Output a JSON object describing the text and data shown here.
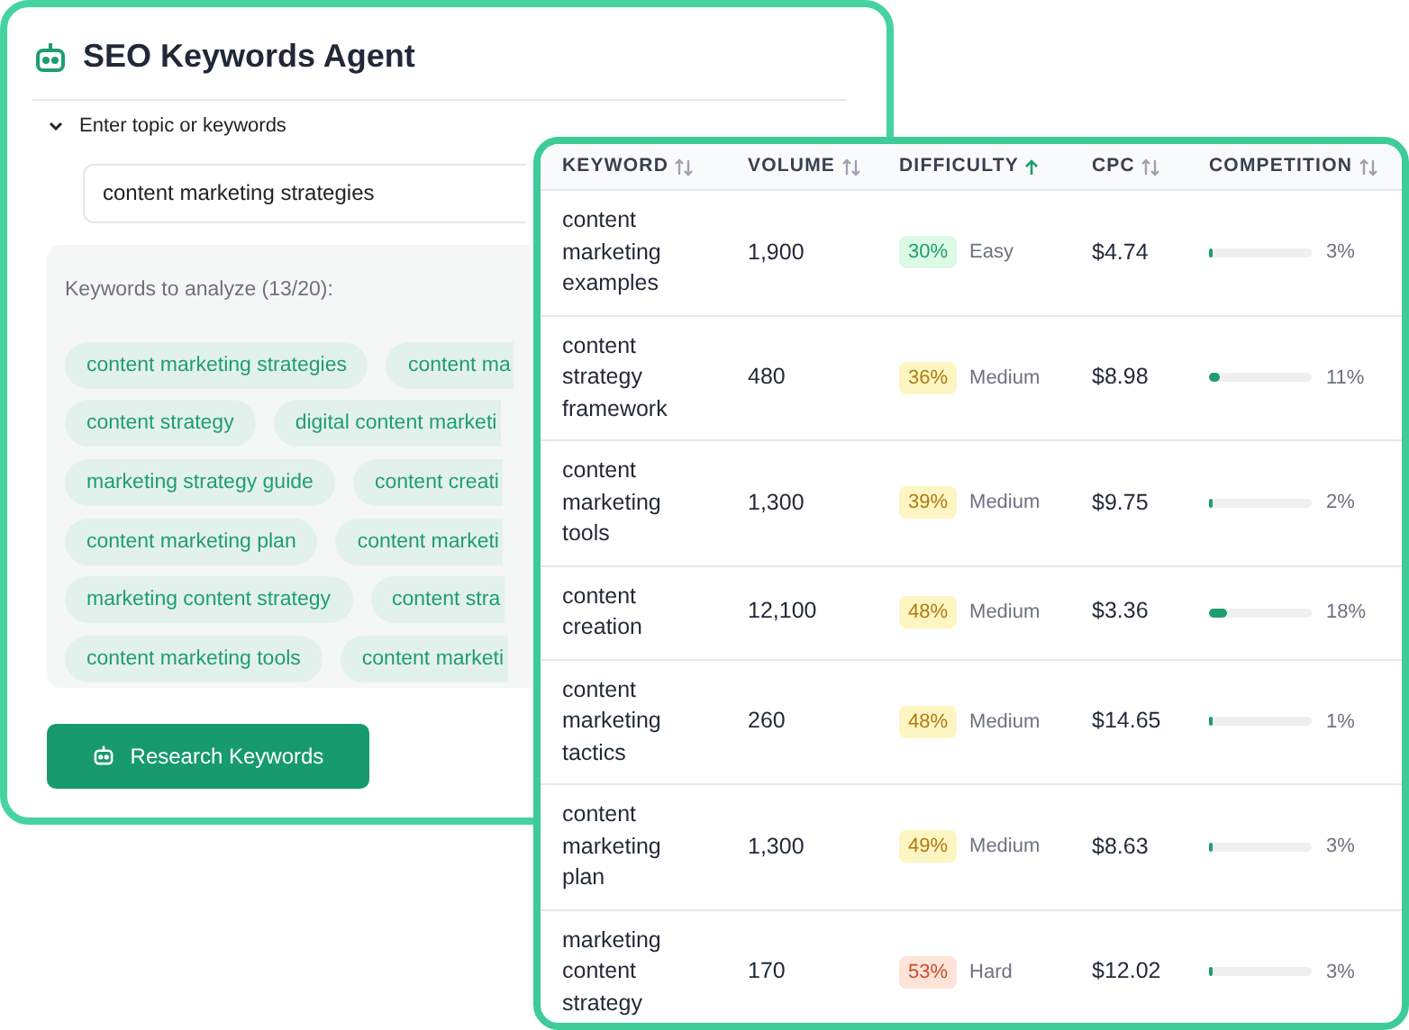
{
  "agent": {
    "title": "SEO Keywords Agent",
    "section_label": "Enter topic or keywords",
    "expanded": true,
    "input": {
      "value": "content marketing strategies"
    },
    "keywords_label": "Keywords to analyze (13/20):",
    "chips": [
      [
        "content marketing strategies",
        "content ma"
      ],
      [
        "content strategy",
        "digital content marketi"
      ],
      [
        "marketing strategy guide",
        "content creati"
      ],
      [
        "content marketing plan",
        "content marketi"
      ],
      [
        "marketing content strategy",
        "content stra"
      ],
      [
        "content marketing tools",
        "content marketi"
      ]
    ],
    "button": "Research Keywords"
  },
  "table": {
    "columns": [
      {
        "label": "KEYWORD",
        "sorted": false
      },
      {
        "label": "VOLUME",
        "sorted": false
      },
      {
        "label": "DIFFICULTY",
        "sorted": true
      },
      {
        "label": "CPC",
        "sorted": false
      },
      {
        "label": "COMPETITION",
        "sorted": false
      }
    ],
    "rows": [
      {
        "keyword": "content marketing examples",
        "volume": "1,900",
        "difficulty": "30%",
        "kind": "easy",
        "rating": "Easy",
        "cpc": "$4.74",
        "level": 0.03,
        "competition": "3%"
      },
      {
        "keyword": "content strategy framework",
        "volume": "480",
        "difficulty": "36%",
        "kind": "medium",
        "rating": "Medium",
        "cpc": "$8.98",
        "level": 0.11,
        "competition": "11%"
      },
      {
        "keyword": "content marketing tools",
        "volume": "1,300",
        "difficulty": "39%",
        "kind": "medium",
        "rating": "Medium",
        "cpc": "$9.75",
        "level": 0.02,
        "competition": "2%"
      },
      {
        "keyword": "content creation",
        "volume": "12,100",
        "difficulty": "48%",
        "kind": "medium",
        "rating": "Medium",
        "cpc": "$3.36",
        "level": 0.18,
        "competition": "18%"
      },
      {
        "keyword": "content marketing tactics",
        "volume": "260",
        "difficulty": "48%",
        "kind": "medium",
        "rating": "Medium",
        "cpc": "$14.65",
        "level": 0.01,
        "competition": "1%"
      },
      {
        "keyword": "content marketing plan",
        "volume": "1,300",
        "difficulty": "49%",
        "kind": "medium",
        "rating": "Medium",
        "cpc": "$8.63",
        "level": 0.03,
        "competition": "3%"
      },
      {
        "keyword": "marketing content strategy",
        "volume": "170",
        "difficulty": "53%",
        "kind": "hard",
        "rating": "Hard",
        "cpc": "$12.02",
        "level": 0.03,
        "competition": "3%"
      }
    ]
  }
}
